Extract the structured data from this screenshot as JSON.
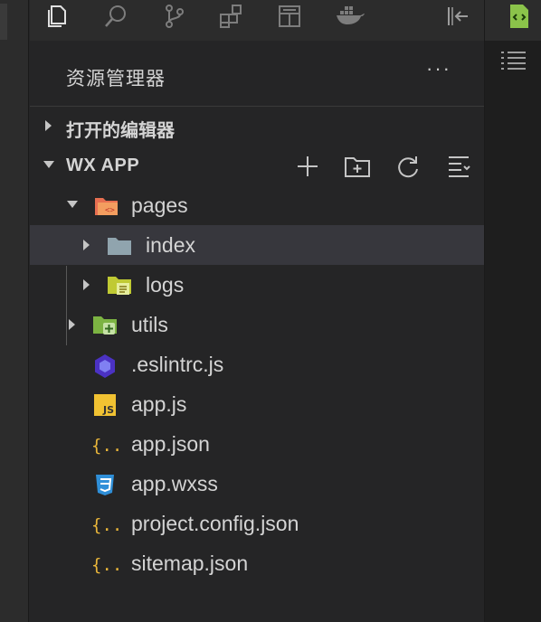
{
  "explorer": {
    "title": "资源管理器",
    "more": "···",
    "open_editors_label": "打开的编辑器",
    "project_label": "WX APP"
  },
  "activity_icons": [
    "files-icon",
    "search-icon",
    "source-control-icon",
    "extensions-icon",
    "layout-icon",
    "docker-icon",
    "collapse-panel-icon"
  ],
  "tree": [
    {
      "name": "pages",
      "type": "folder",
      "expanded": true
    },
    {
      "name": "index",
      "type": "folder",
      "expanded": false,
      "selected": true
    },
    {
      "name": "logs",
      "type": "folder",
      "expanded": false
    },
    {
      "name": "utils",
      "type": "folder",
      "expanded": false
    },
    {
      "name": ".eslintrc.js",
      "type": "file"
    },
    {
      "name": "app.js",
      "type": "file"
    },
    {
      "name": "app.json",
      "type": "file"
    },
    {
      "name": "app.wxss",
      "type": "file"
    },
    {
      "name": "project.config.json",
      "type": "file"
    },
    {
      "name": "sitemap.json",
      "type": "file"
    }
  ],
  "colors": {
    "background": "#252526",
    "activity_bar": "#2c2c2c",
    "selected_row": "#37373d",
    "text": "#d4d4d4",
    "json_icon": "#e8b53a",
    "js_icon": "#f1c232",
    "css_icon": "#2f8fd8",
    "eslint_icon": "#4b32c3",
    "pages_folder": "#e76f51",
    "utils_folder": "#7cb342",
    "logs_folder": "#c0ca33",
    "index_folder": "#90a4ae",
    "wxml_icon": "#8bc34a"
  }
}
